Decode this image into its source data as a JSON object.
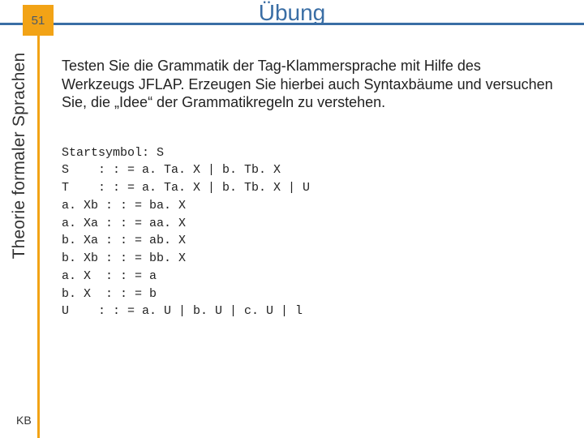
{
  "page_number": "51",
  "title": "Übung",
  "sidebar_label": "Theorie formaler Sprachen",
  "footer": "KB",
  "intro_text": "Testen Sie die Grammatik der Tag-Klammersprache mit Hilfe des Werkzeugs JFLAP. Erzeugen Sie hierbei auch Syntaxbäume und versuchen Sie, die „Idee“ der Grammatikregeln zu verstehen.",
  "grammar_lines": [
    "Startsymbol: S",
    "S    : : = a. Ta. X | b. Tb. X",
    "T    : : = a. Ta. X | b. Tb. X | U",
    "a. Xb : : = ba. X",
    "a. Xa : : = aa. X",
    "b. Xa : : = ab. X",
    "b. Xb : : = bb. X",
    "a. X  : : = a",
    "b. X  : : = b",
    "U    : : = a. U | b. U | c. U | l"
  ]
}
